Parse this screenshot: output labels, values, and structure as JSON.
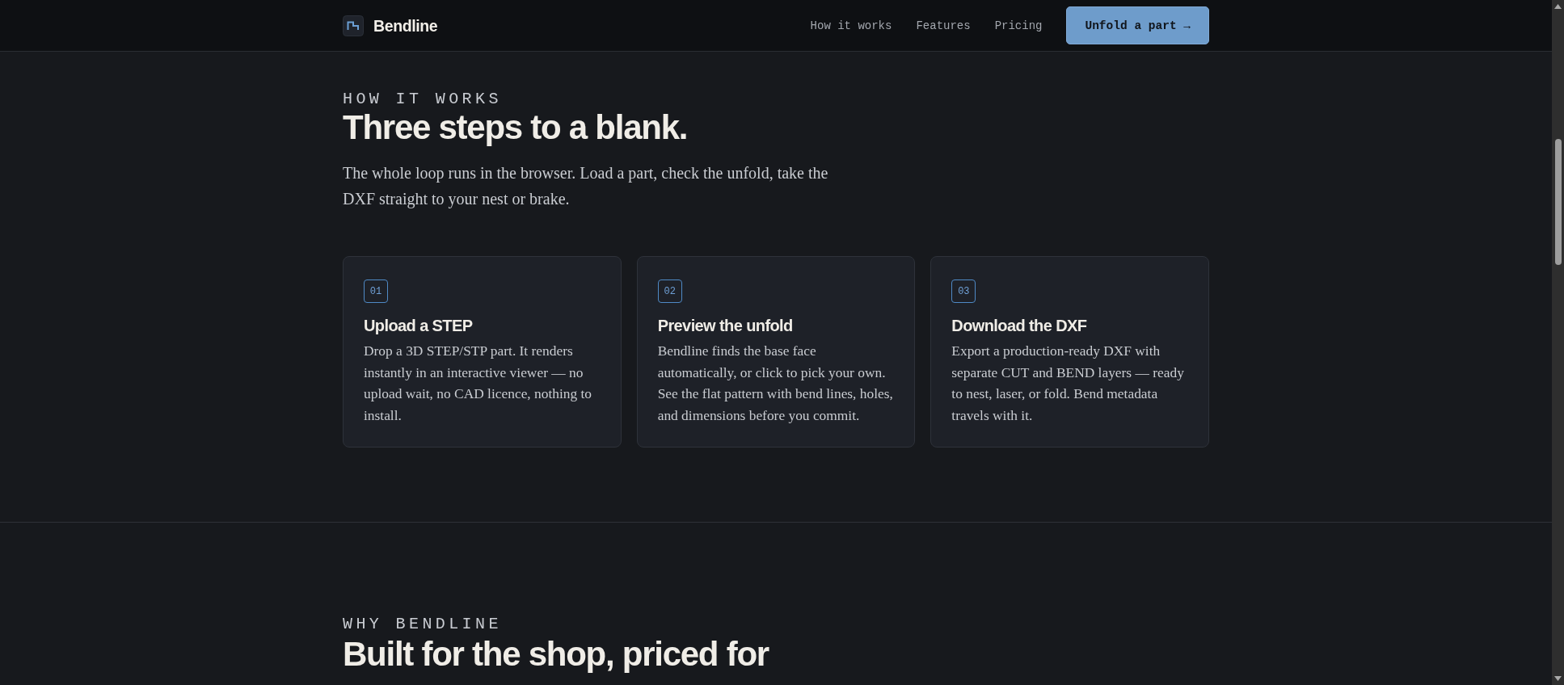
{
  "header": {
    "brand": "Bendline",
    "nav": [
      {
        "label": "How it works"
      },
      {
        "label": "Features"
      },
      {
        "label": "Pricing"
      }
    ],
    "cta": "Unfold a part →"
  },
  "sections": [
    {
      "eyebrow": "HOW IT WORKS",
      "title": "Three steps to a blank.",
      "lead": "The whole loop runs in the browser. Load a part, check the unfold, take the DXF straight to your nest or brake.",
      "steps": [
        {
          "number": "01",
          "title": "Upload a STEP",
          "text": "Drop a 3D STEP/STP part. It renders instantly in an interactive viewer — no upload wait, no CAD licence, nothing to install."
        },
        {
          "number": "02",
          "title": "Preview the unfold",
          "text": "Bendline finds the base face automatically, or click to pick your own. See the flat pattern with bend lines, holes, and dimensions before you commit."
        },
        {
          "number": "03",
          "title": "Download the DXF",
          "text": "Export a production-ready DXF with separate CUT and BEND layers — ready to nest, laser, or fold. Bend metadata travels with it."
        }
      ]
    },
    {
      "eyebrow": "WHY BENDLINE",
      "title": "Built for the shop, priced for"
    }
  ]
}
